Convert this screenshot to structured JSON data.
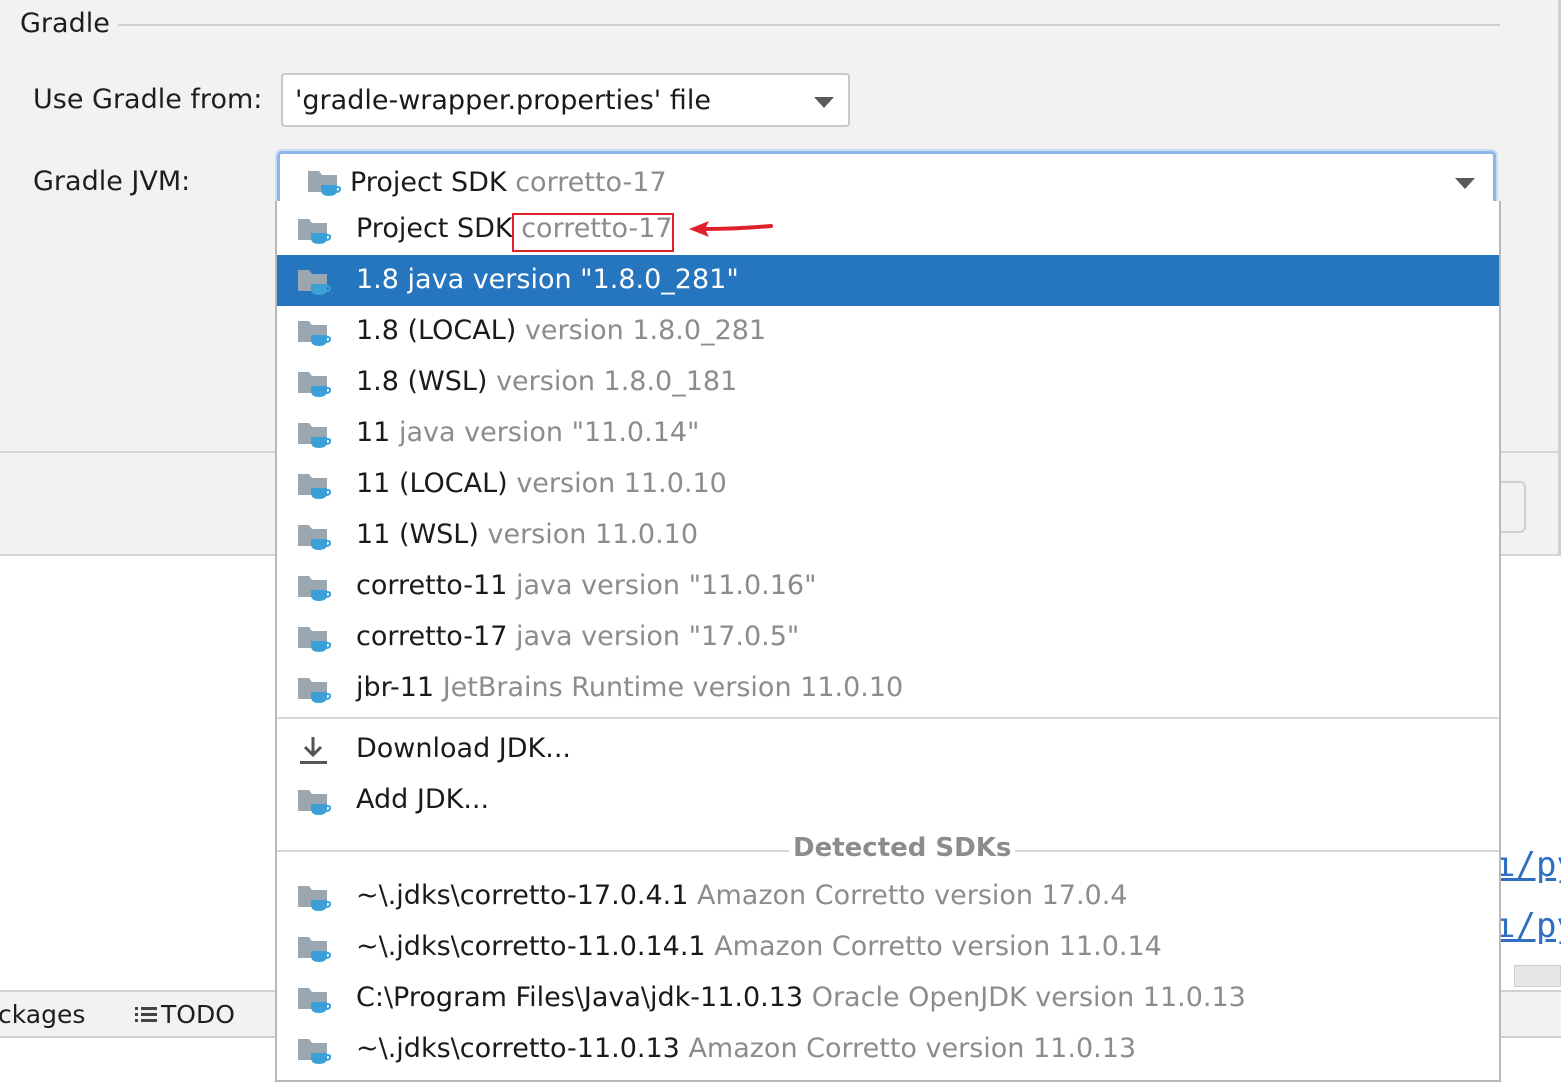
{
  "gradle": {
    "section_title": "Gradle",
    "use_gradle_from": {
      "label": "Use Gradle from:",
      "value": "'gradle-wrapper.properties' file"
    },
    "gradle_jvm": {
      "label": "Gradle JVM:",
      "value_name": "Project SDK",
      "value_version": "corretto-17"
    }
  },
  "popup": {
    "items": [
      {
        "name": "Project SDK",
        "version": "corretto-17",
        "icon": "jdk-folder-icon"
      },
      {
        "name": "1.8",
        "version": "java version \"1.8.0_281\"",
        "icon": "jdk-folder-icon",
        "selected": true
      },
      {
        "name": "1.8 (LOCAL)",
        "version": "version 1.8.0_281",
        "icon": "jdk-folder-icon"
      },
      {
        "name": "1.8 (WSL)",
        "version": "version 1.8.0_181",
        "icon": "jdk-folder-icon"
      },
      {
        "name": "11",
        "version": "java version \"11.0.14\"",
        "icon": "jdk-folder-icon"
      },
      {
        "name": "11 (LOCAL)",
        "version": "version 11.0.10",
        "icon": "jdk-folder-icon"
      },
      {
        "name": "11 (WSL)",
        "version": "version 11.0.10",
        "icon": "jdk-folder-icon"
      },
      {
        "name": "corretto-11",
        "version": "java version \"11.0.16\"",
        "icon": "jdk-folder-icon"
      },
      {
        "name": "corretto-17",
        "version": "java version \"17.0.5\"",
        "icon": "jdk-folder-icon"
      },
      {
        "name": "jbr-11",
        "version": "JetBrains Runtime version 11.0.10",
        "icon": "jdk-folder-icon"
      }
    ],
    "actions": [
      {
        "label": "Download JDK...",
        "icon": "download-icon"
      },
      {
        "label": "Add JDK...",
        "icon": "jdk-folder-icon"
      }
    ],
    "detected_title": "Detected SDKs",
    "detected": [
      {
        "name": "~\\.jdks\\corretto-17.0.4.1",
        "version": "Amazon Corretto version 17.0.4"
      },
      {
        "name": "~\\.jdks\\corretto-11.0.14.1",
        "version": "Amazon Corretto version 11.0.14"
      },
      {
        "name": "C:\\Program Files\\Java\\jdk-11.0.13",
        "version": "Oracle OpenJDK version 11.0.13"
      },
      {
        "name": "~\\.jdks\\corretto-11.0.13",
        "version": "Amazon Corretto version 11.0.13"
      }
    ]
  },
  "background": {
    "links": [
      "ı/py",
      "ı/py"
    ],
    "tabs": {
      "packages": "ckages",
      "todo": "TODO"
    }
  },
  "colors": {
    "selection": "#2675bf",
    "annotation": "#e0202a",
    "icon_cup": "#3ba0d8"
  }
}
